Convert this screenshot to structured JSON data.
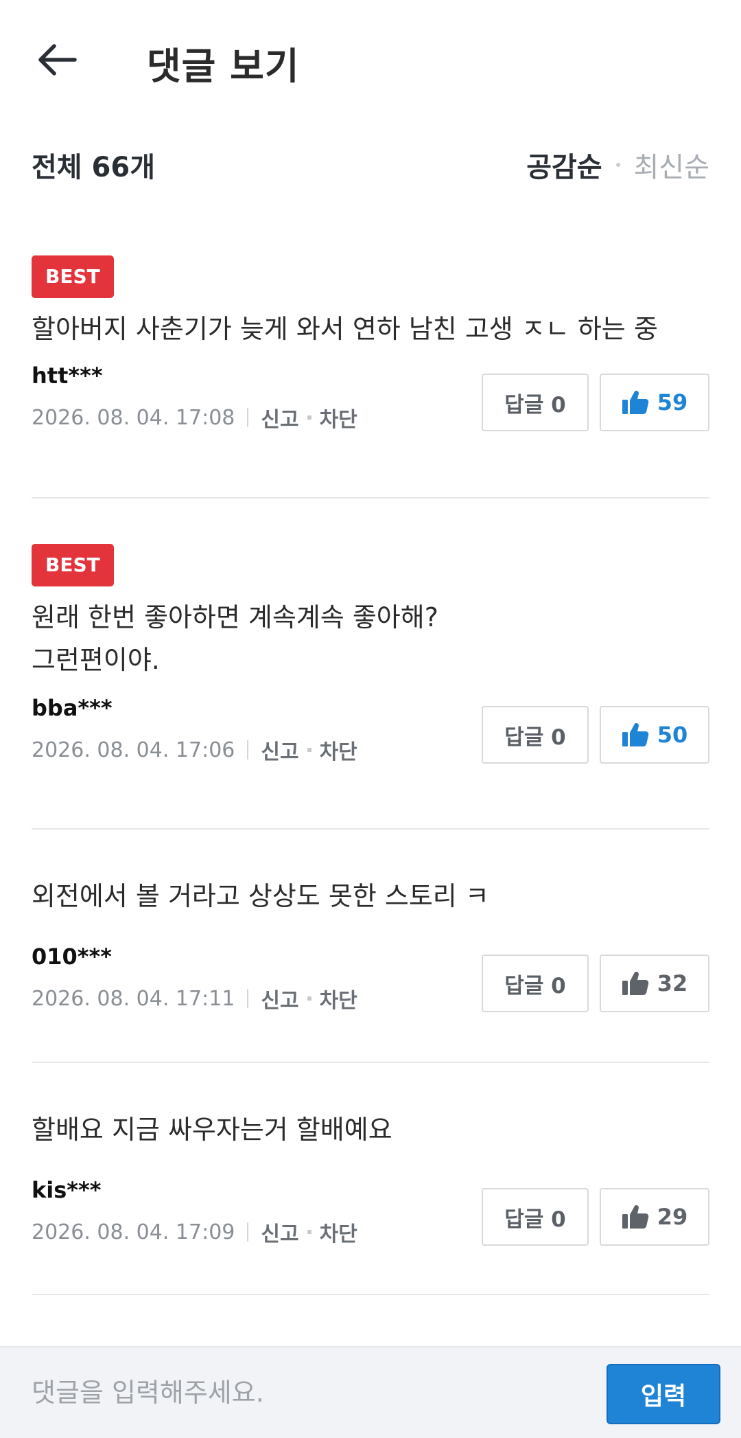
{
  "header": {
    "title": "댓글 보기"
  },
  "summary": {
    "total": "전체 66개",
    "sort_popular": "공감순",
    "sort_latest": "최신순"
  },
  "comments": [
    {
      "best": "BEST",
      "text": "할아버지 사춘기가 늦게 와서 연하 남친 고생 ㅈㄴ 하는 중",
      "author": "htt***",
      "date": "2026. 08. 04. 17:08",
      "report": "신고",
      "block": "차단",
      "reply": "답글 0",
      "likes": "59"
    },
    {
      "best": "BEST",
      "text": "원래 한번 좋아하면 계속계속 좋아해?\n그런편이야.",
      "author": "bba***",
      "date": "2026. 08. 04. 17:06",
      "report": "신고",
      "block": "차단",
      "reply": "답글 0",
      "likes": "50"
    },
    {
      "text": "외전에서 볼 거라고 상상도 못한 스토리 ㅋ",
      "author": "010***",
      "date": "2026. 08. 04. 17:11",
      "report": "신고",
      "block": "차단",
      "reply": "답글 0",
      "likes": "32"
    },
    {
      "text": "할배요 지금 싸우자는거 할배예요",
      "author": "kis***",
      "date": "2026. 08. 04. 17:09",
      "report": "신고",
      "block": "차단",
      "reply": "답글 0",
      "likes": "29"
    }
  ],
  "input": {
    "placeholder": "댓글을 입력해주세요.",
    "submit": "입력"
  },
  "colors": {
    "accent": "#1f84d6",
    "best_badge": "#e2343a"
  }
}
